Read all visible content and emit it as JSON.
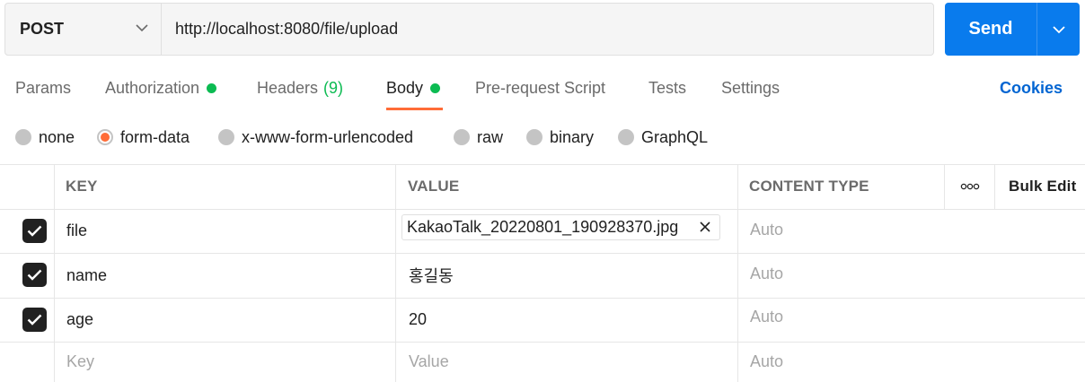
{
  "request": {
    "method": "POST",
    "url": "http://localhost:8080/file/upload",
    "send_label": "Send"
  },
  "tabs": [
    {
      "label": "Params"
    },
    {
      "label": "Authorization",
      "indicator": "green-dot"
    },
    {
      "label": "Headers",
      "count": "(9)"
    },
    {
      "label": "Body",
      "indicator": "green-dot",
      "active": true
    },
    {
      "label": "Pre-request Script"
    },
    {
      "label": "Tests"
    },
    {
      "label": "Settings"
    }
  ],
  "cookies_label": "Cookies",
  "body_types": [
    {
      "label": "none"
    },
    {
      "label": "form-data",
      "selected": true
    },
    {
      "label": "x-www-form-urlencoded"
    },
    {
      "label": "raw"
    },
    {
      "label": "binary"
    },
    {
      "label": "GraphQL"
    }
  ],
  "table": {
    "headers": {
      "key": "KEY",
      "value": "VALUE",
      "content_type": "CONTENT TYPE",
      "bulk_edit": "Bulk Edit"
    },
    "rows": [
      {
        "checked": true,
        "key": "file",
        "value": "KakaoTalk_20220801_190928370.jpg",
        "value_type": "file",
        "content_type": "Auto"
      },
      {
        "checked": true,
        "key": "name",
        "value": "홍길동",
        "content_type": "Auto"
      },
      {
        "checked": true,
        "key": "age",
        "value": "20",
        "content_type": "Auto"
      }
    ],
    "new_row": {
      "key_placeholder": "Key",
      "value_placeholder": "Value",
      "content_type_placeholder": "Auto"
    }
  },
  "colors": {
    "accent": "#ff6c37",
    "send_button": "#097bed",
    "status_green": "#0cbb52",
    "link_blue": "#0265d2"
  },
  "icons": [
    "chevron-down-icon",
    "more-horizontal-icon",
    "checkbox-checked-icon",
    "close-icon"
  ]
}
